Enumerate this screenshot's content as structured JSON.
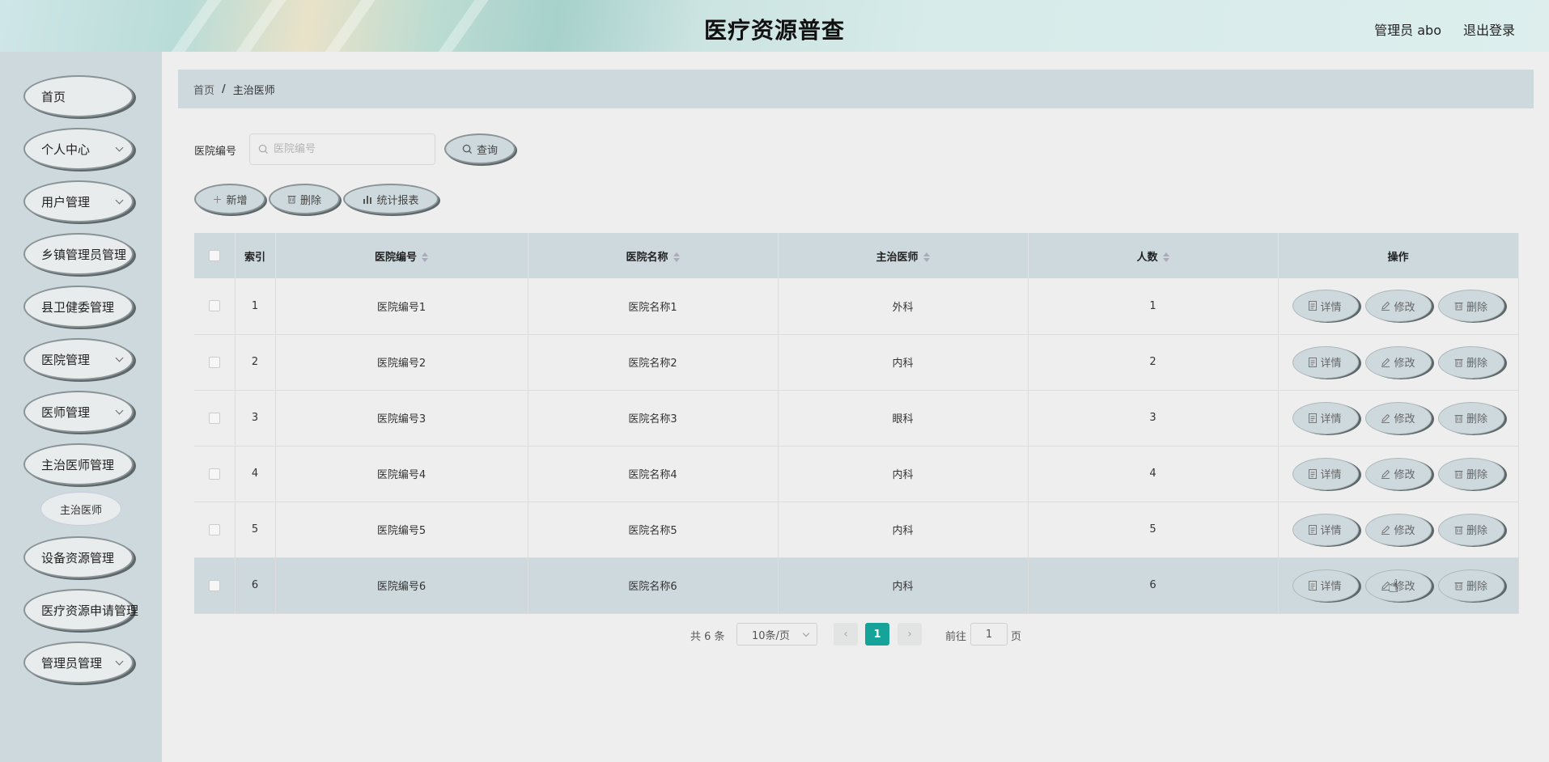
{
  "header": {
    "title": "医疗资源普查",
    "user": "管理员 abo",
    "logout": "退出登录"
  },
  "sidebar": {
    "items": [
      {
        "label": "首页",
        "has_children": false
      },
      {
        "label": "个人中心",
        "has_children": true
      },
      {
        "label": "用户管理",
        "has_children": true
      },
      {
        "label": "乡镇管理员管理",
        "has_children": false
      },
      {
        "label": "县卫健委管理",
        "has_children": false
      },
      {
        "label": "医院管理",
        "has_children": true
      },
      {
        "label": "医师管理",
        "has_children": true
      },
      {
        "label": "主治医师管理",
        "has_children": false
      },
      {
        "label": "设备资源管理",
        "has_children": false
      },
      {
        "label": "医疗资源申请管理",
        "has_children": false
      },
      {
        "label": "管理员管理",
        "has_children": true
      }
    ],
    "submenu_active": "主治医师"
  },
  "breadcrumb": {
    "home": "首页",
    "separator": "/",
    "current": "主治医师"
  },
  "search": {
    "label": "医院编号",
    "placeholder": "医院编号",
    "button": "查询"
  },
  "toolbar": {
    "add": "新增",
    "delete": "删除",
    "report": "统计报表"
  },
  "table": {
    "columns": [
      "索引",
      "医院编号",
      "医院名称",
      "主治医师",
      "人数",
      "操作"
    ],
    "rows": [
      {
        "index": "1",
        "code": "医院编号1",
        "name": "医院名称1",
        "doctor": "外科",
        "count": "1"
      },
      {
        "index": "2",
        "code": "医院编号2",
        "name": "医院名称2",
        "doctor": "内科",
        "count": "2"
      },
      {
        "index": "3",
        "code": "医院编号3",
        "name": "医院名称3",
        "doctor": "眼科",
        "count": "3"
      },
      {
        "index": "4",
        "code": "医院编号4",
        "name": "医院名称4",
        "doctor": "内科",
        "count": "4"
      },
      {
        "index": "5",
        "code": "医院编号5",
        "name": "医院名称5",
        "doctor": "内科",
        "count": "5"
      },
      {
        "index": "6",
        "code": "医院编号6",
        "name": "医院名称6",
        "doctor": "内科",
        "count": "6"
      }
    ],
    "actions": {
      "detail": "详情",
      "edit": "修改",
      "delete": "删除"
    }
  },
  "pagination": {
    "total": "共 6 条",
    "page_size": "10条/页",
    "current": "1",
    "goto_label": "前往",
    "goto_value": "1",
    "page_suffix": "页"
  }
}
